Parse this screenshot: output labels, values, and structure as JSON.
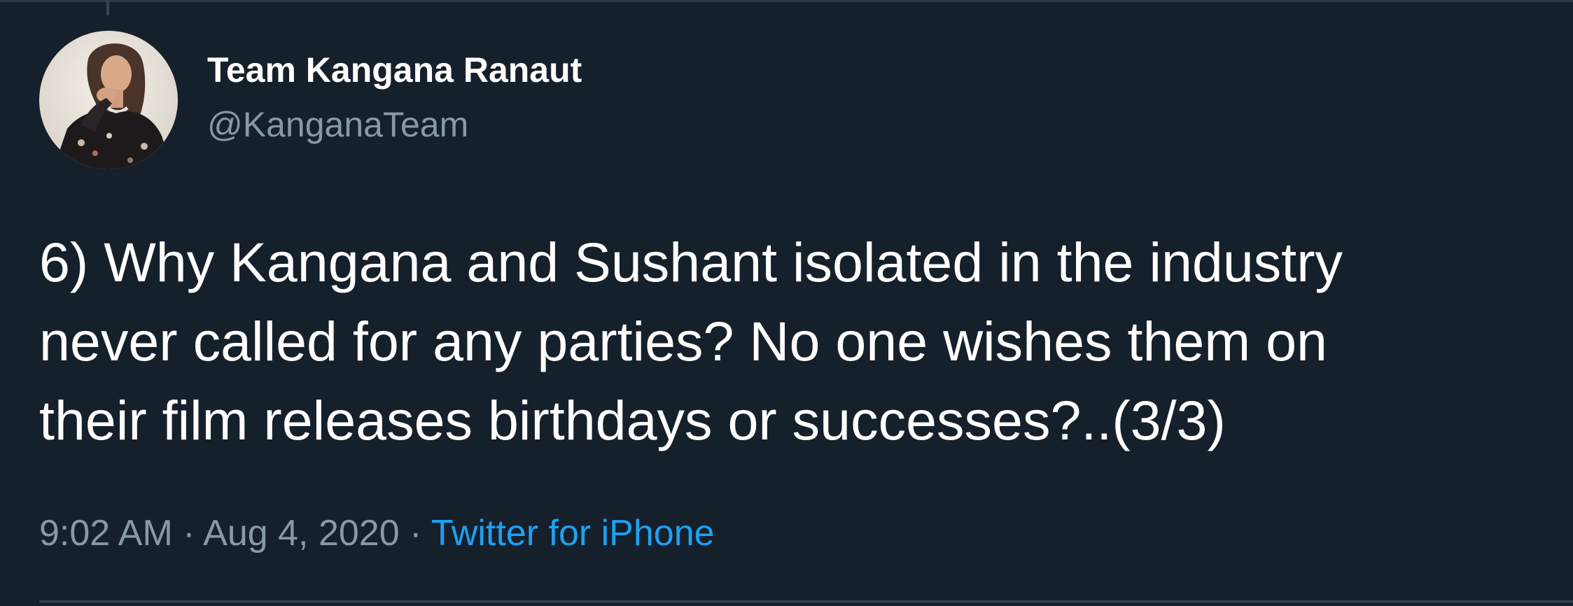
{
  "author": {
    "display_name": "Team Kangana Ranaut",
    "handle": "@KanganaTeam",
    "avatar_icon": "profile-photo"
  },
  "tweet": {
    "lines": [
      "6) Why Kangana and Sushant isolated in the industry",
      "never called for any parties? No one wishes them on",
      "their film releases birthdays or successes?..(3/3)"
    ]
  },
  "meta": {
    "time": "9:02 AM",
    "separator": "·",
    "date": "Aug 4, 2020",
    "source": "Twitter for iPhone"
  },
  "colors": {
    "background": "#15202b",
    "primary_text": "#ffffff",
    "secondary_text": "#8899a6",
    "link": "#1da1f2"
  }
}
